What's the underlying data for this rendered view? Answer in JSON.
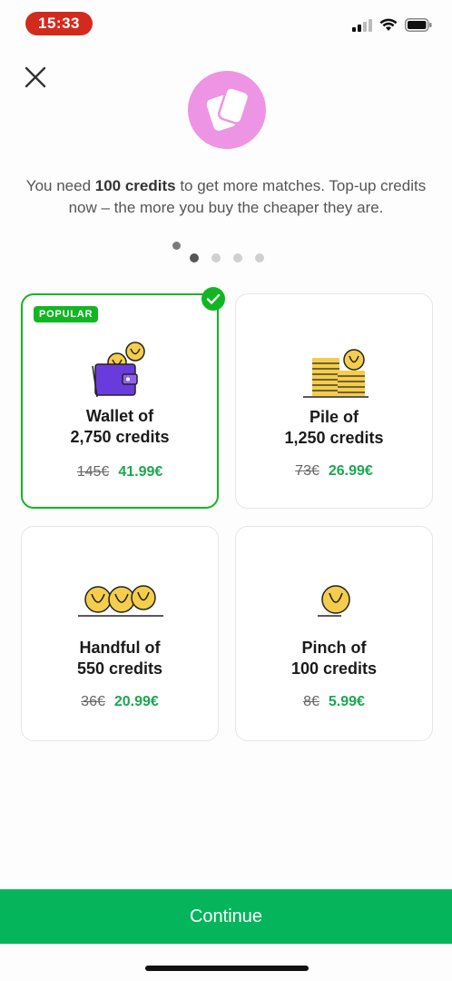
{
  "status": {
    "time": "15:33"
  },
  "intro": {
    "prefix": "You need ",
    "bold": "100 credits",
    "suffix": " to get more matches. Top-up credits now – the more you buy the cheaper they are."
  },
  "pager": {
    "count": 4,
    "active": 0
  },
  "cards": [
    {
      "line1": "Wallet of",
      "line2": "2,750 credits",
      "old_price": "145€",
      "new_price": "41.99€",
      "badge": "POPULAR",
      "selected": true
    },
    {
      "line1": "Pile of",
      "line2": "1,250 credits",
      "old_price": "73€",
      "new_price": "26.99€",
      "selected": false
    },
    {
      "line1": "Handful of",
      "line2": "550 credits",
      "old_price": "36€",
      "new_price": "20.99€",
      "selected": false
    },
    {
      "line1": "Pinch of",
      "line2": "100 credits",
      "old_price": "8€",
      "new_price": "5.99€",
      "selected": false
    }
  ],
  "continue_label": "Continue",
  "colors": {
    "accent": "#12b623",
    "button": "#05b55b",
    "price": "#1aa84f",
    "hero": "#ee94e4",
    "time_pill": "#d32a1e"
  }
}
